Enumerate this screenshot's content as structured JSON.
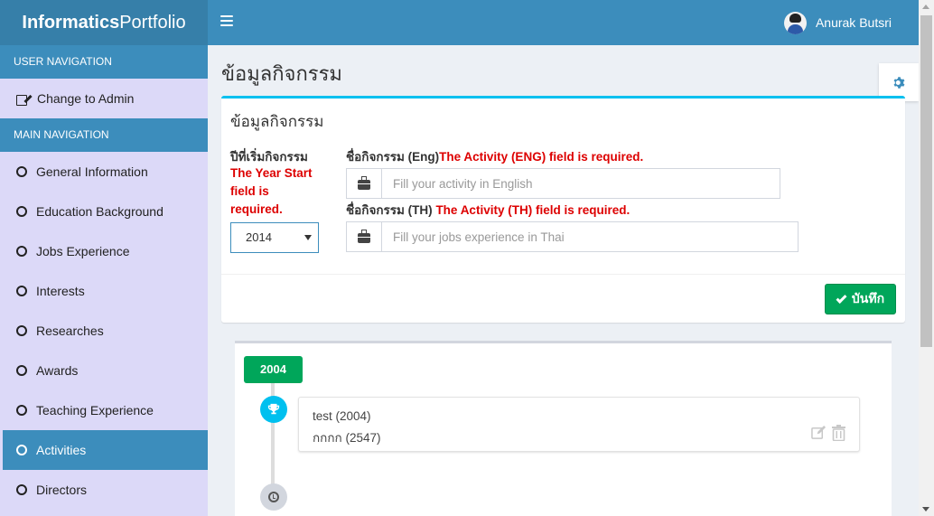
{
  "brand": {
    "bold": "Informatics",
    "light": "Portfolio"
  },
  "header": {
    "menu_icon": "hamburger-icon",
    "user_name": "Anurak Butsri"
  },
  "sidebar": {
    "user_nav_header": "USER NAVIGATION",
    "user_items": [
      {
        "label": "Change to Admin",
        "icon": "edit-icon"
      }
    ],
    "main_nav_header": "MAIN NAVIGATION",
    "items": [
      {
        "label": "General Information",
        "icon": "circle-icon"
      },
      {
        "label": "Education Background",
        "icon": "circle-icon"
      },
      {
        "label": "Jobs Experience",
        "icon": "circle-icon"
      },
      {
        "label": "Interests",
        "icon": "circle-icon"
      },
      {
        "label": "Researches",
        "icon": "circle-icon"
      },
      {
        "label": "Awards",
        "icon": "circle-icon"
      },
      {
        "label": "Teaching Experience",
        "icon": "circle-icon"
      },
      {
        "label": "Activities",
        "icon": "circle-icon",
        "active": true
      },
      {
        "label": "Directors",
        "icon": "circle-icon"
      }
    ]
  },
  "page": {
    "title": "ข้อมูลกิจกรรม",
    "settings_icon": "gear-icon"
  },
  "form": {
    "title": "ข้อมูลกิจกรรม",
    "year_label": "ปีที่เริ่มกิจกรรม",
    "year_error": "The Year Start field is required.",
    "year_value": "2014",
    "eng_label": "ชื่อกิจกรรม (Eng)",
    "eng_error": "The Activity (ENG) field is required.",
    "eng_placeholder": "Fill your activity in English",
    "th_label": "ชื่อกิจกรรม (TH)",
    "th_error": "The Activity (TH) field is required.",
    "th_placeholder": "Fill your jobs experience in Thai",
    "save_label": "บันทึก"
  },
  "timeline": {
    "year": "2004",
    "items": [
      {
        "line1": "test (2004)",
        "line2": "กกกก (2547)",
        "icon": "trophy-icon"
      }
    ],
    "end_icon": "clock-icon"
  },
  "colors": {
    "primary": "#3c8dbc",
    "brand_bg": "#367fa9",
    "sidebar_bg": "#dcd9f8",
    "success": "#00a65a",
    "info": "#00c0ef",
    "error": "#dd0000"
  }
}
